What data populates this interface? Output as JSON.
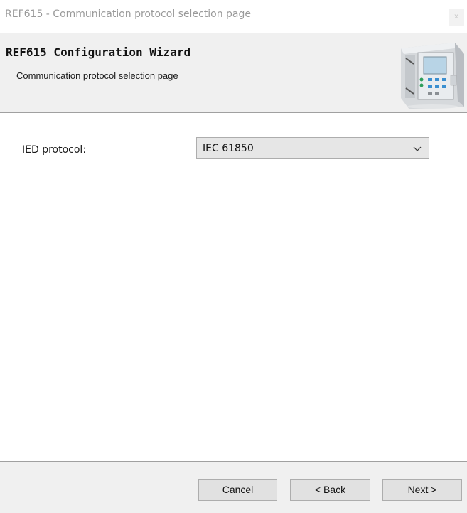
{
  "window": {
    "title": "REF615 - Communication protocol selection page",
    "close_label": "x"
  },
  "header": {
    "title": "REF615 Configuration Wizard",
    "subtitle": "Communication protocol selection page"
  },
  "form": {
    "protocol_label": "IED protocol:",
    "protocol_value": "IEC 61850"
  },
  "footer": {
    "cancel_label": "Cancel",
    "back_label": "< Back",
    "next_label": "Next >"
  }
}
